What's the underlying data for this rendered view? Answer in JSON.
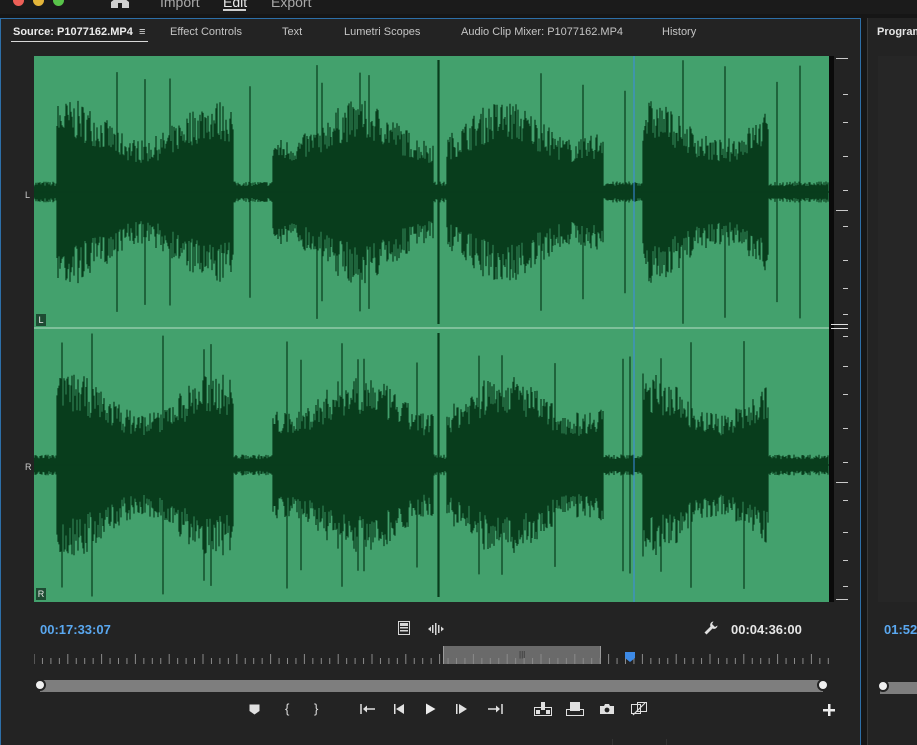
{
  "app": {
    "workspace_tabs": [
      "Import",
      "Edit",
      "Export"
    ],
    "active_workspace": "Edit",
    "home_icon": "home-icon"
  },
  "source_panel": {
    "tabs": {
      "source": "Source: P1077162.MP4",
      "effect_controls": "Effect Controls",
      "text": "Text",
      "lumetri": "Lumetri Scopes",
      "mixer": "Audio Clip Mixer: P1077162.MP4",
      "history": "History"
    },
    "panel_menu_icon": "≡",
    "waveform": {
      "background_color": "#43a16d",
      "wave_color": "#083d1c",
      "channels": [
        {
          "side_label": "L",
          "tag": "L"
        },
        {
          "side_label": "R",
          "tag": "R"
        }
      ]
    },
    "playhead_timecode": "00:17:33:07",
    "duration_timecode": "00:04:36:00",
    "accent_color": "#5aa8f0",
    "transport_icons": [
      "add-marker-icon",
      "mark-in-icon",
      "mark-out-icon",
      "go-to-in-icon",
      "step-back-icon",
      "play-icon",
      "step-forward-icon",
      "go-to-out-icon",
      "insert-icon",
      "overwrite-icon",
      "export-frame-icon",
      "drag-video-audio-icon",
      "add-button-icon"
    ]
  },
  "program_panel": {
    "title": "Program",
    "timecode": "01:52"
  }
}
